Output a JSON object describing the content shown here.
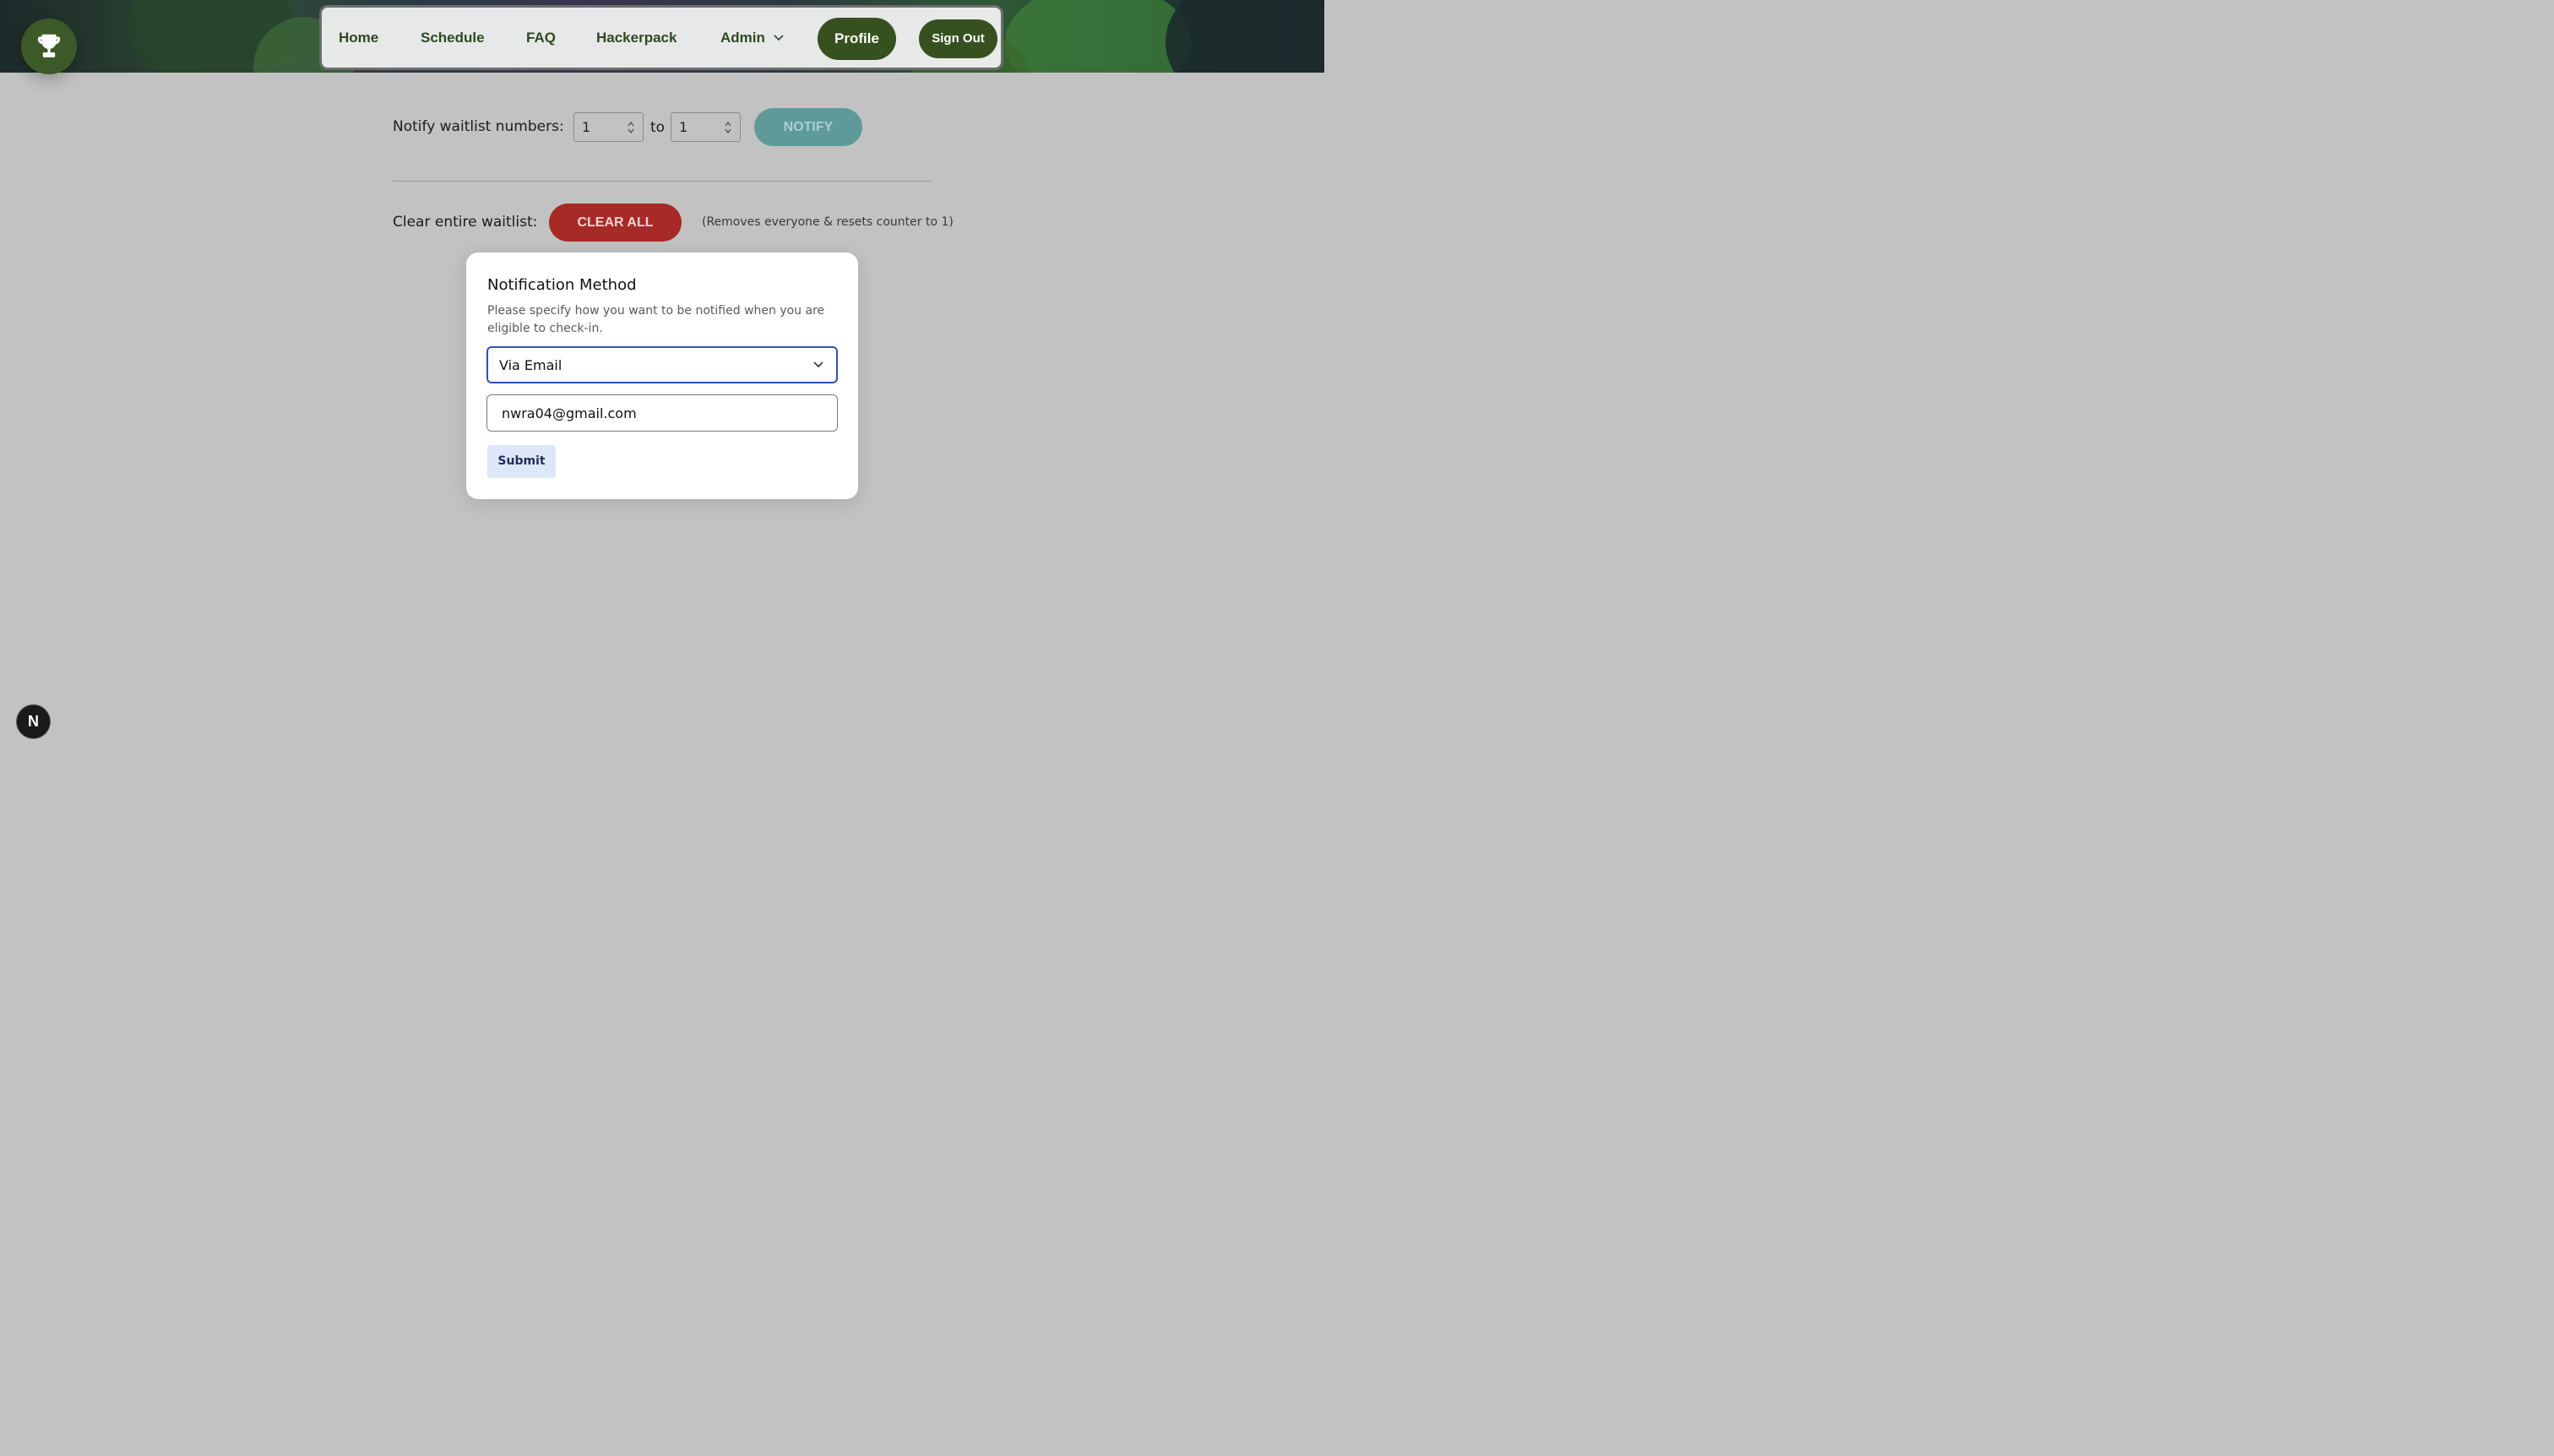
{
  "nav": {
    "links": [
      "Home",
      "Schedule",
      "FAQ",
      "Hackerpack"
    ],
    "admin_label": "Admin",
    "profile_label": "Profile",
    "signout_label": "Sign Out"
  },
  "waitlist": {
    "notify_label": "Notify waitlist numbers:",
    "from_value": "1",
    "to_label": "to",
    "to_value": "1",
    "notify_button": "NOTIFY",
    "clear_label": "Clear entire waitlist:",
    "clear_button": "CLEAR ALL",
    "clear_note": "(Removes everyone & resets counter to 1)"
  },
  "modal": {
    "title": "Notification Method",
    "description": "Please specify how you want to be notified when you are eligible to check-in.",
    "method_selected": "Via Email",
    "email_value": "nwra04@gmail.com",
    "submit_label": "Submit"
  },
  "dev_badge": "N",
  "colors": {
    "brand_green": "#36511f",
    "notify_teal": "#5e9a9a",
    "clear_red": "#a82a26",
    "focus_blue": "#2f4fbf",
    "submit_bg": "#dde7f7"
  }
}
